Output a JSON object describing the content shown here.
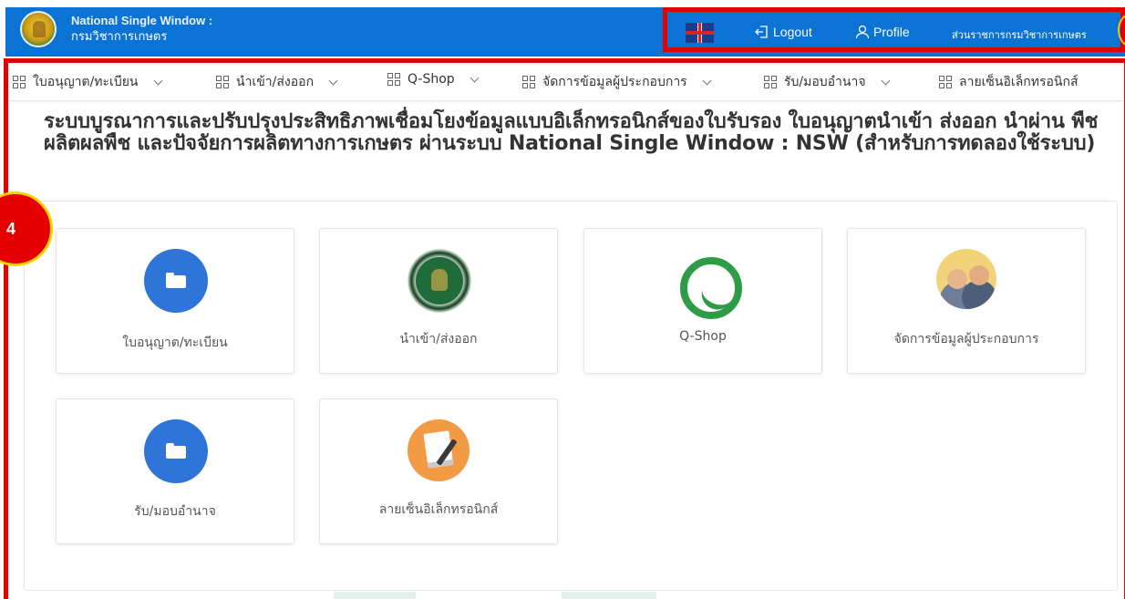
{
  "header": {
    "brand_line1": "National Single Window :",
    "brand_line2": "กรมวิชาการเกษตร",
    "logout_label": "Logout",
    "profile_label": "Profile",
    "agency_label": "ส่วนราชการกรมวิชาการเกษตร",
    "colors": {
      "bar": "#0a73d4",
      "highlight_border": "#e30000"
    }
  },
  "menu": {
    "items": [
      {
        "label": "ใบอนุญาต/ทะเบียน"
      },
      {
        "label": "นำเข้า/ส่งออก"
      },
      {
        "label": "Q-Shop"
      },
      {
        "label": "จัดการข้อมูลผู้ประกอบการ"
      },
      {
        "label": "รับ/มอบอำนาจ"
      },
      {
        "label": "ลายเซ็นอิเล็กทรอนิกส์"
      }
    ]
  },
  "main": {
    "title": "ระบบบูรณาการและปรับปรุงประสิทธิภาพเชื่อมโยงข้อมูลแบบอิเล็กทรอนิกส์ของใบรับรอง ใบอนุญาตนำเข้า ส่งออก นำผ่าน พืช ผลิตผลพืช และปัจจัยการผลิตทางการเกษตร ผ่านระบบ National Single Window : NSW (สำหรับการทดลองใช้ระบบ)",
    "cards": [
      {
        "label": "ใบอนุญาต/ทะเบียน",
        "icon": "folder-icon"
      },
      {
        "label": "นำเข้า/ส่งออก",
        "icon": "department-seal-icon"
      },
      {
        "label": "Q-Shop",
        "icon": "q-shop-logo-icon"
      },
      {
        "label": "จัดการข้อมูลผู้ประกอบการ",
        "icon": "people-icon"
      },
      {
        "label": "รับ/มอบอำนาจ",
        "icon": "folder-icon"
      },
      {
        "label": "ลายเซ็นอิเล็กทรอนิกส์",
        "icon": "signature-document-icon"
      }
    ]
  },
  "annotation": {
    "badge_number": "4"
  }
}
